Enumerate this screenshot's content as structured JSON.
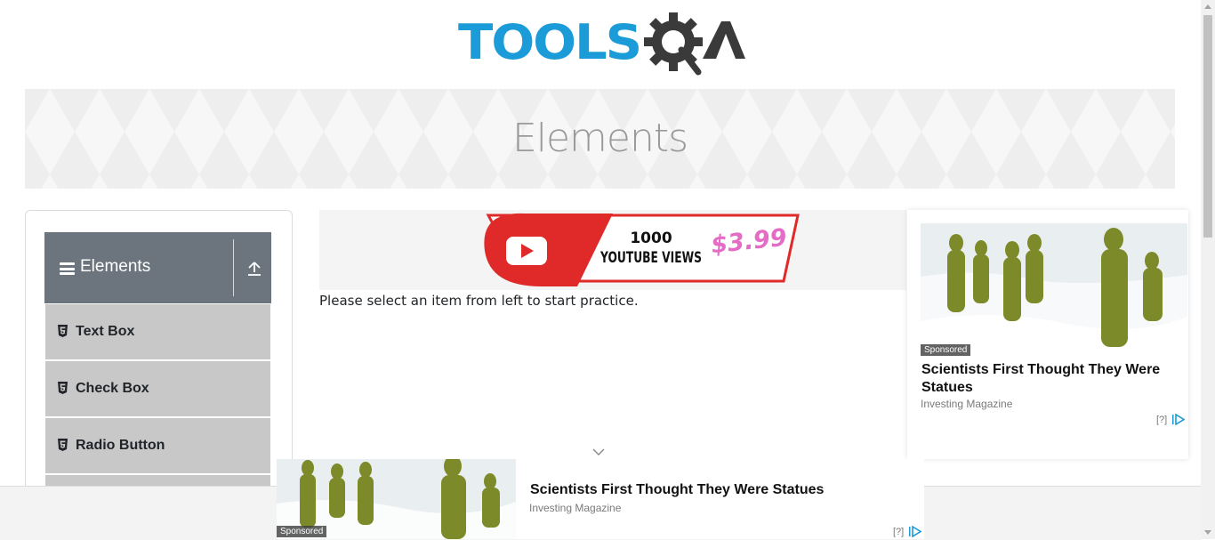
{
  "header": {
    "logo_text_left": "TOOLS",
    "logo_text_right": "QA",
    "colors": {
      "logo_blue": "#1b9bd7",
      "logo_dark": "#3a3a3a"
    }
  },
  "banner": {
    "title": "Elements"
  },
  "sidebar": {
    "group_title": "Elements",
    "group_icon": "hamburger-icon",
    "collapse_icon": "upload-arrow-icon",
    "items": [
      {
        "label": "Text Box",
        "icon": "html5-icon"
      },
      {
        "label": "Check Box",
        "icon": "html5-icon"
      },
      {
        "label": "Radio Button",
        "icon": "html5-icon"
      }
    ],
    "colors": {
      "header_bg": "#6c757d",
      "item_bg": "#c8c8c8"
    }
  },
  "center": {
    "promo": {
      "line1": "1000",
      "line2": "YOUTUBE VIEWS",
      "price": "$3.99"
    },
    "instruction": "Please select an item from left to start practice.",
    "scroll_hint_icon": "chevron-down-icon"
  },
  "ads": {
    "right": {
      "badge": "Sponsored",
      "title": "Scientists First Thought They Were Statues",
      "source": "Investing Magazine",
      "info": "[?]"
    },
    "bottom": {
      "badge": "Sponsored",
      "title": "Scientists First Thought They Were Statues",
      "source": "Investing Magazine",
      "info": "[?]"
    }
  }
}
